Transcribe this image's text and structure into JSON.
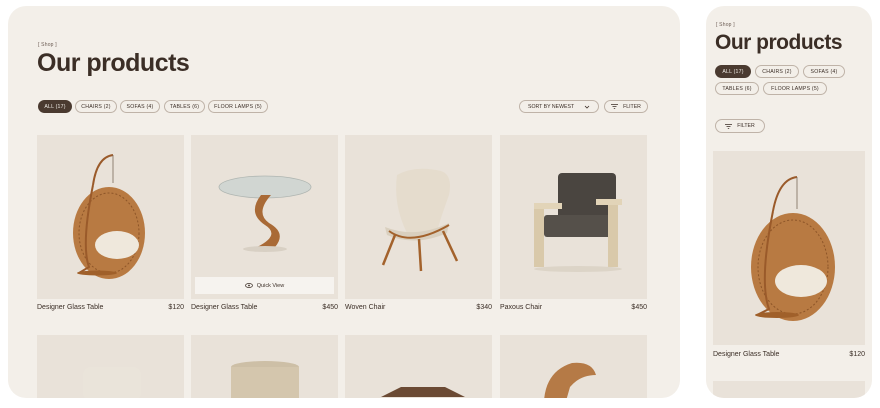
{
  "desktop": {
    "breadcrumb": "[ Shop ]",
    "title": "Our products",
    "filters": [
      {
        "label": "ALL (17)",
        "active": true
      },
      {
        "label": "CHAIRS (2)",
        "active": false
      },
      {
        "label": "SOFAS (4)",
        "active": false
      },
      {
        "label": "TABLES (6)",
        "active": false
      },
      {
        "label": "FLOOR LAMPS (5)",
        "active": false
      }
    ],
    "sort_label": "SORT BY NEWEST",
    "filter_label": "FLITER",
    "quick_view_label": "Quick View",
    "products": [
      {
        "name": "Designer Glass Table",
        "price": "$120",
        "icon": "hanging-egg-chair"
      },
      {
        "name": "Designer Glass Table",
        "price": "$450",
        "icon": "glass-table"
      },
      {
        "name": "Woven Chair",
        "price": "$340",
        "icon": "lounge-chair"
      },
      {
        "name": "Paxous Chair",
        "price": "$450",
        "icon": "armchair"
      }
    ],
    "second_row_icons": [
      "sofa",
      "drum-lamp",
      "coffee-table",
      "wood-chair"
    ]
  },
  "mobile": {
    "breadcrumb": "[ Shop ]",
    "title": "Our products",
    "filters": [
      {
        "label": "ALL (17)",
        "active": true
      },
      {
        "label": "CHAIRS (2)",
        "active": false
      },
      {
        "label": "SOFAS (4)",
        "active": false
      },
      {
        "label": "TABLES (6)",
        "active": false
      },
      {
        "label": "FLOOR LAMPS (5)",
        "active": false
      }
    ],
    "filter_label": "FILTER",
    "product": {
      "name": "Designer Glass Table",
      "price": "$120",
      "icon": "hanging-egg-chair"
    }
  },
  "colors": {
    "background": "#f3efe9",
    "card": "#e9e2d9",
    "accent": "#4a3a30"
  }
}
